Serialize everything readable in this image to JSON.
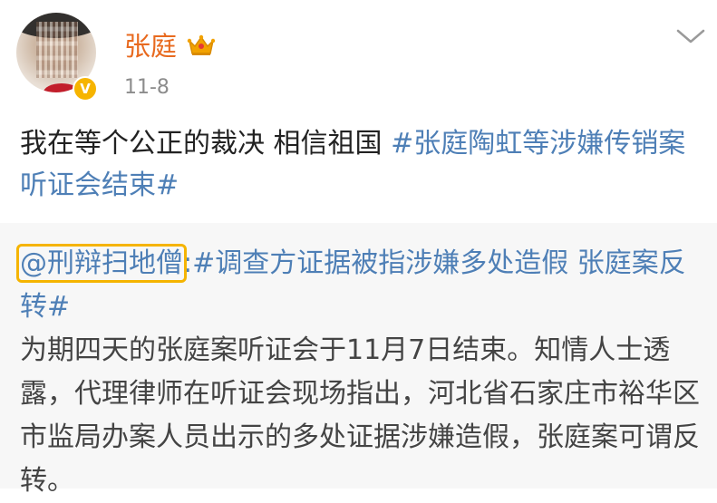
{
  "post": {
    "user": {
      "name": "张庭",
      "verified_badge": "V",
      "badge_icon": "crown-icon"
    },
    "time": "11-8",
    "text_plain": "我在等个公正的裁决 相信祖国 ",
    "text_topic": "#张庭陶虹等涉嫌传销案听证会结束#"
  },
  "repost": {
    "mention": "@刑辩扫地僧",
    "colon": ":",
    "topic": "#调查方证据被指涉嫌多处造假 张庭案反转#",
    "body": "为期四天的张庭案听证会于11月7日结束。知情人士透露，代理律师在听证会现场指出，河北省石家庄市裕华区市监局办案人员出示的多处证据涉嫌造假，张庭案可谓反转。"
  },
  "colors": {
    "username": "#e86a1f",
    "link": "#4e7fb6",
    "highlight_box": "#f5b400",
    "repost_bg": "#f7f7f7",
    "verify_badge": "#f6b400"
  }
}
